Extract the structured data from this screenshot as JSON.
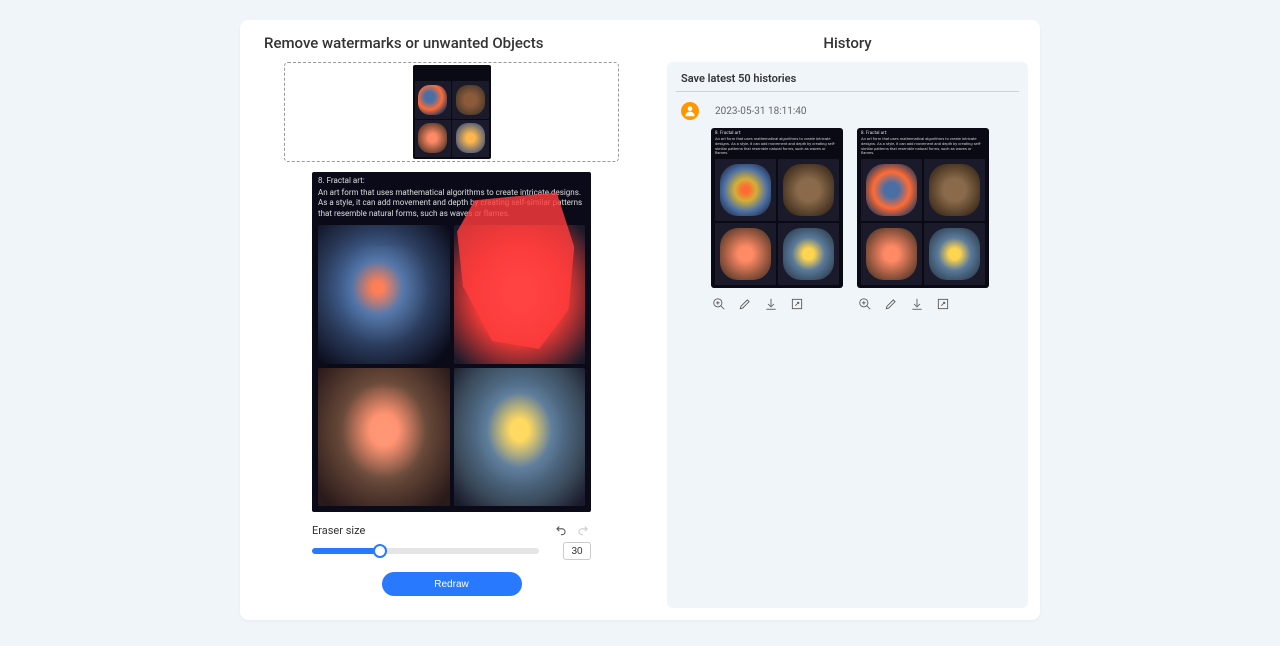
{
  "left": {
    "title": "Remove watermarks or unwanted Objects",
    "image_caption_title": "8. Fractal art:",
    "image_caption_body": "An art form that uses mathematical algorithms to create intricate designs. As a style, it can add movement and depth by creating self-similar patterns that resemble natural forms, such as waves or flames.",
    "eraser_label": "Eraser size",
    "eraser_value": "30",
    "redraw_label": "Redraw",
    "icons": {
      "undo": "undo-icon",
      "redo": "redo-icon"
    }
  },
  "right": {
    "title": "History",
    "header": "Save latest 50 histories",
    "items": [
      {
        "timestamp": "2023-05-31 18:11:40",
        "caption_title": "8. Fractal art:",
        "caption_body": "An art form that uses mathematical algorithms to create intricate designs. As a style, it can add movement and depth by creating self-similar patterns that resemble natural forms, such as waves or flames."
      }
    ],
    "actions": [
      "zoom",
      "edit",
      "download",
      "expand"
    ]
  }
}
